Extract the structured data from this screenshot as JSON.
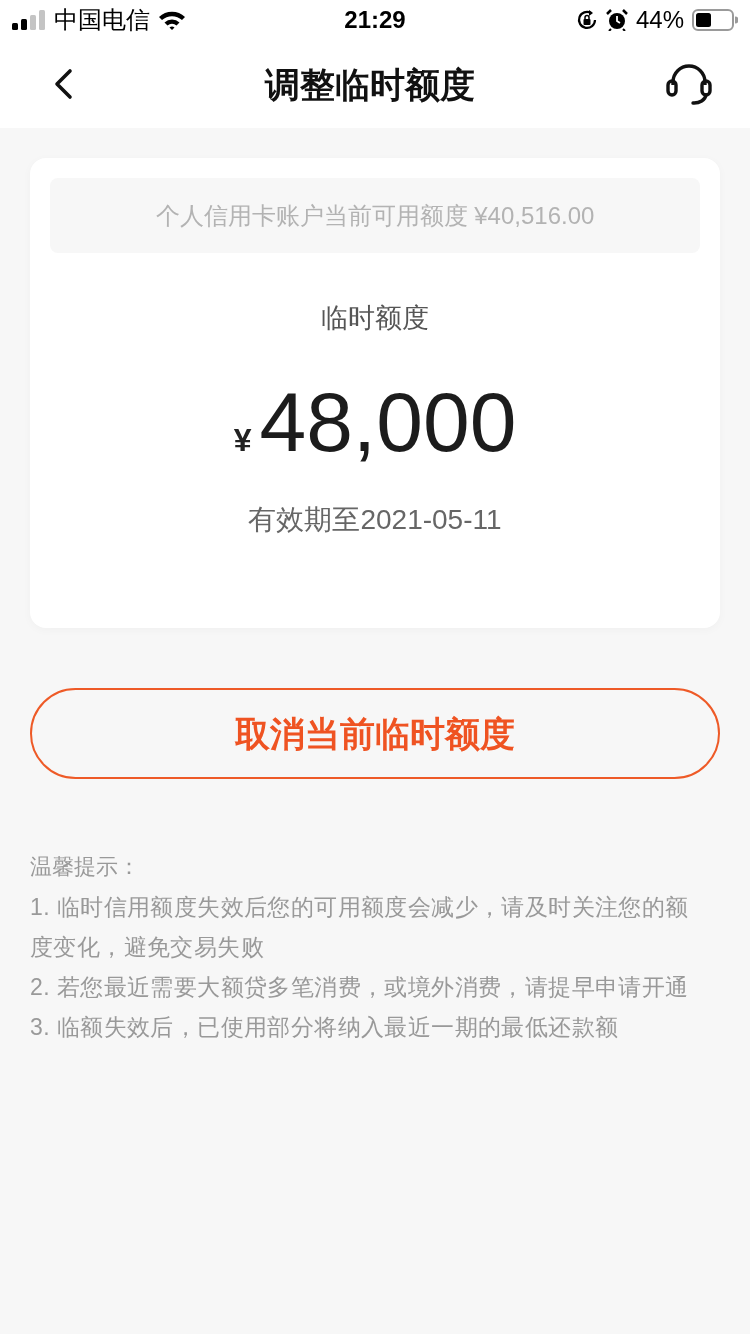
{
  "status_bar": {
    "carrier": "中国电信",
    "time": "21:29",
    "battery": "44%"
  },
  "nav": {
    "title": "调整临时额度"
  },
  "card": {
    "available": "个人信用卡账户当前可用额度 ¥40,516.00",
    "label": "临时额度",
    "currency": "¥",
    "amount": "48,000",
    "validity": "有效期至2021-05-11"
  },
  "cancel_button": {
    "label": "取消当前临时额度"
  },
  "tips": {
    "title": "温馨提示：",
    "items": [
      "1. 临时信用额度失效后您的可用额度会减少，请及时关注您的额度变化，避免交易失败",
      "2. 若您最近需要大额贷多笔消费，或境外消费，请提早申请开通",
      "3. 临额失效后，已使用部分将纳入最近一期的最低还款额"
    ]
  }
}
